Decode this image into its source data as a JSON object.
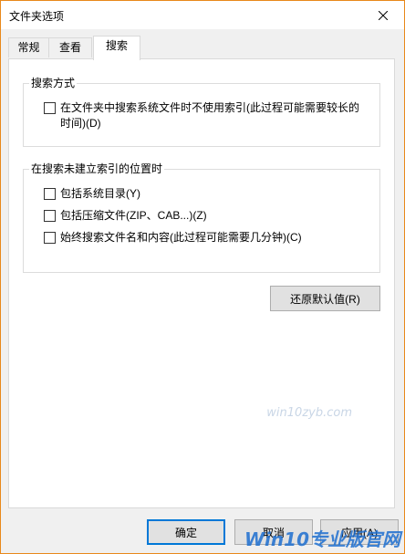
{
  "window": {
    "title": "文件夹选项"
  },
  "tabs": [
    {
      "label": "常规"
    },
    {
      "label": "查看"
    },
    {
      "label": "搜索"
    }
  ],
  "groups": {
    "search_method": {
      "legend": "搜索方式",
      "options": [
        {
          "label_line1": "在文件夹中搜索系统文件时不使用索引(此过程可能需要较长的",
          "label_line2": "时间)(D)",
          "checked": false
        }
      ]
    },
    "non_indexed": {
      "legend": "在搜索未建立索引的位置时",
      "options": [
        {
          "label": "包括系统目录(Y)",
          "checked": false
        },
        {
          "label": "包括压缩文件(ZIP、CAB...)(Z)",
          "checked": false
        },
        {
          "label": "始终搜索文件名和内容(此过程可能需要几分钟)(C)",
          "checked": false
        }
      ]
    }
  },
  "buttons": {
    "restore_defaults": "还原默认值(R)",
    "ok": "确定",
    "cancel": "取消",
    "apply": "应用(A)"
  },
  "watermark": {
    "small": "win10zyb.com",
    "large": "Win10专业版官网"
  },
  "colors": {
    "accent": "#0078d7",
    "window_border": "#e8881a",
    "watermark": "#1e6fd0"
  }
}
